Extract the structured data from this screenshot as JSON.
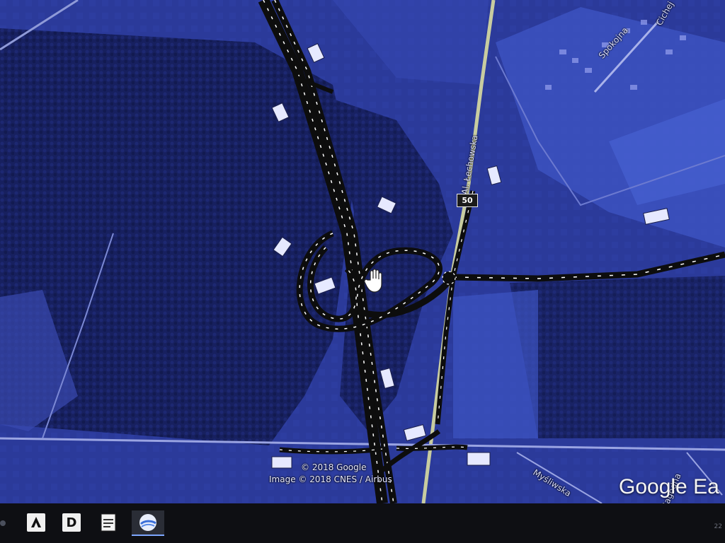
{
  "map": {
    "streets": {
      "lechowska": "Al. Łechowska",
      "spokojna": "Spokojna",
      "cichej": "Cichej",
      "mysliwska": "Myśliwska",
      "jagodna": "Jagodna"
    },
    "route_number": "50",
    "copyright_line1": "© 2018 Google",
    "copyright_line2": "Image © 2018 CNES / Airbus",
    "brand": "Google Ea"
  },
  "taskbar": {
    "apps": [
      {
        "name": "acrobat",
        "letter": "A"
      },
      {
        "name": "d-app",
        "letter": "D"
      },
      {
        "name": "notepad",
        "letter": ""
      },
      {
        "name": "google-earth",
        "letter": "",
        "active": true
      }
    ],
    "clock": "22"
  },
  "colors": {
    "map_bg": "#1e2a7e",
    "field": "#3b4fb8",
    "forest": "#141c5c",
    "road": "#111111",
    "road_dash": "#ffffff",
    "label": "#d8dcff"
  },
  "icons": {
    "cursor": "hand-cursor-icon",
    "photo_markers": "photo-marker-icon"
  }
}
